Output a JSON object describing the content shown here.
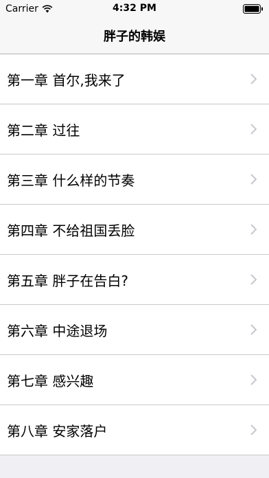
{
  "status_bar": {
    "carrier": "Carrier",
    "wifi_icon": "wifi-icon",
    "time": "4:32 PM",
    "battery_icon": "battery-full-icon"
  },
  "nav": {
    "title": "胖子的韩娱"
  },
  "chapters": [
    {
      "label": "第一章 首尔,我来了",
      "icon": "chevron-right-icon"
    },
    {
      "label": "第二章 过往",
      "icon": "chevron-right-icon"
    },
    {
      "label": "第三章 什么样的节奏",
      "icon": "chevron-right-icon"
    },
    {
      "label": "第四章 不给祖国丢脸",
      "icon": "chevron-right-icon"
    },
    {
      "label": "第五章 胖子在告白?",
      "icon": "chevron-right-icon"
    },
    {
      "label": "第六章 中途退场",
      "icon": "chevron-right-icon"
    },
    {
      "label": "第七章 感兴趣",
      "icon": "chevron-right-icon"
    },
    {
      "label": "第八章 安家落户",
      "icon": "chevron-right-icon"
    }
  ],
  "colors": {
    "bar_background": "#f7f7f7",
    "list_background": "#ffffff",
    "separator": "#c8c7cc",
    "chevron": "#c7c7cc"
  }
}
